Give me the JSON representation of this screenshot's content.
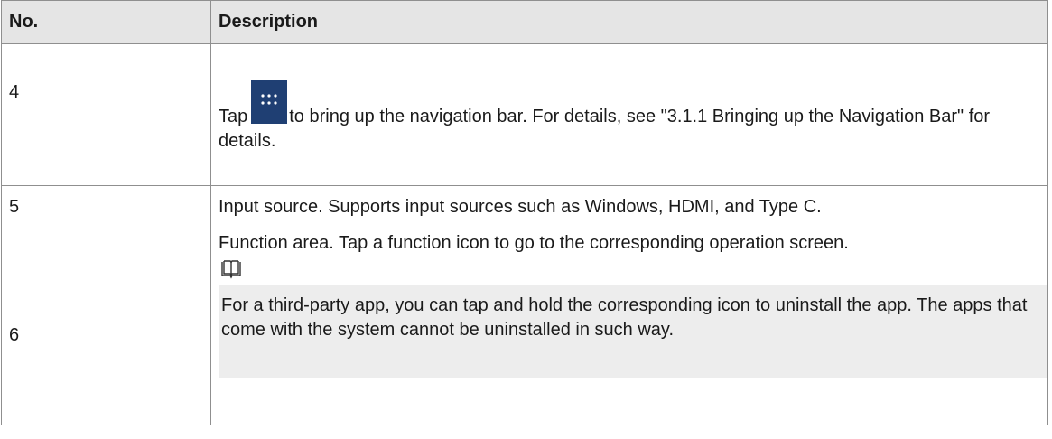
{
  "table": {
    "headers": {
      "no": "No.",
      "description": "Description"
    },
    "row4": {
      "no": "4",
      "text_before_icon": "Tap",
      "text_after_icon": "to bring up the navigation bar. For details, see \"3.1.1 Bringing up the Navigation Bar\" for details.",
      "icon": "apps-grid-icon"
    },
    "row5": {
      "no": "5",
      "description": "Input source. Supports input sources such as Windows, HDMI, and Type C."
    },
    "row6": {
      "no": "6",
      "description": "Function area. Tap a function icon to go to the corresponding operation screen.",
      "note_icon": "book-icon",
      "note": "For a third-party app, you can tap and hold the corresponding icon to uninstall the app. The apps that come with the system cannot be uninstalled in such way."
    }
  },
  "colors": {
    "header_bg": "#e5e5e5",
    "note_bg": "#ededed",
    "icon_tile": "#1f3f73",
    "border": "#8f8f8f"
  }
}
